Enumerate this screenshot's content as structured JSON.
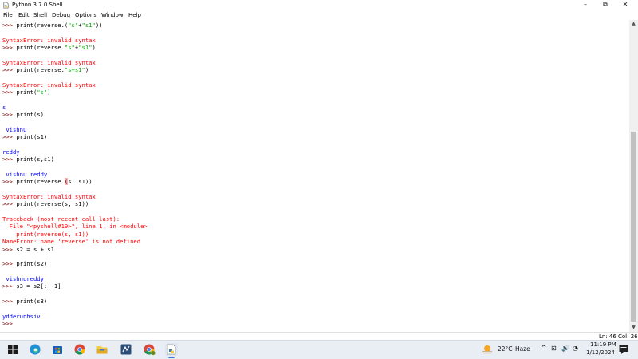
{
  "window": {
    "title": "Python 3.7.0 Shell"
  },
  "window_controls": {
    "minimize": "–",
    "maximize": "⧉",
    "close": "✕"
  },
  "menu": [
    "File",
    "Edit",
    "Shell",
    "Debug",
    "Options",
    "Window",
    "Help"
  ],
  "shell_lines": [
    [
      [
        "prompt",
        ">>> "
      ],
      [
        "code",
        "print(reverse.("
      ],
      [
        "str",
        "\"s\""
      ],
      [
        "code",
        "+"
      ],
      [
        "str",
        "\"s1\""
      ],
      [
        "code",
        "))"
      ]
    ],
    [],
    [
      [
        "err",
        "SyntaxError: invalid syntax"
      ]
    ],
    [
      [
        "prompt",
        ">>> "
      ],
      [
        "code",
        "print(reverse."
      ],
      [
        "str",
        "\"s\""
      ],
      [
        "code",
        "+"
      ],
      [
        "str",
        "\"s1\""
      ],
      [
        "code",
        ")"
      ]
    ],
    [],
    [
      [
        "err",
        "SyntaxError: invalid syntax"
      ]
    ],
    [
      [
        "prompt",
        ">>> "
      ],
      [
        "code",
        "print(reverse."
      ],
      [
        "str",
        "\"s+s1\""
      ],
      [
        "code",
        ")"
      ]
    ],
    [],
    [
      [
        "err",
        "SyntaxError: invalid syntax"
      ]
    ],
    [
      [
        "prompt",
        ">>> "
      ],
      [
        "code",
        "print("
      ],
      [
        "str",
        "\"s\""
      ],
      [
        "code",
        ")"
      ]
    ],
    [],
    [
      [
        "out",
        "s"
      ]
    ],
    [
      [
        "prompt",
        ">>> "
      ],
      [
        "code",
        "print(s)"
      ]
    ],
    [],
    [
      [
        "out",
        " vishnu"
      ]
    ],
    [
      [
        "prompt",
        ">>> "
      ],
      [
        "code",
        "print(s1)"
      ]
    ],
    [],
    [
      [
        "out",
        "reddy"
      ]
    ],
    [
      [
        "prompt",
        ">>> "
      ],
      [
        "code",
        "print(s,s1)"
      ]
    ],
    [],
    [
      [
        "out",
        " vishnu reddy"
      ]
    ],
    [
      [
        "prompt",
        ">>> "
      ],
      [
        "code",
        "print(reverse."
      ],
      [
        "hl",
        "("
      ],
      [
        "code",
        "s, s1))"
      ],
      [
        "cursor",
        ""
      ]
    ],
    [],
    [
      [
        "err",
        "SyntaxError: invalid syntax"
      ]
    ],
    [
      [
        "prompt",
        ">>> "
      ],
      [
        "code",
        "print(reverse(s, s1))"
      ]
    ],
    [],
    [
      [
        "err",
        "Traceback (most recent call last):"
      ]
    ],
    [
      [
        "err",
        "  File \"<pyshell#19>\", line 1, in <module>"
      ]
    ],
    [
      [
        "err",
        "    print(reverse(s, s1))"
      ]
    ],
    [
      [
        "err",
        "NameError: name 'reverse' is not defined"
      ]
    ],
    [
      [
        "prompt",
        ">>> "
      ],
      [
        "code",
        "s2 = s + s1"
      ]
    ],
    [],
    [
      [
        "prompt",
        ">>> "
      ],
      [
        "code",
        "print(s2)"
      ]
    ],
    [],
    [
      [
        "out",
        " vishnureddy"
      ]
    ],
    [
      [
        "prompt",
        ">>> "
      ],
      [
        "code",
        "s3 = s2[::-1]"
      ]
    ],
    [],
    [
      [
        "prompt",
        ">>> "
      ],
      [
        "code",
        "print(s3)"
      ]
    ],
    [],
    [
      [
        "out",
        "ydderunhsiv"
      ]
    ],
    [
      [
        "prompt",
        ">>> "
      ]
    ]
  ],
  "status": {
    "line": "Ln: 46",
    "col": "Col: 26"
  },
  "taskbar": {
    "weather_temp": "22°C",
    "weather_desc": "Haze",
    "time": "11:19 PM",
    "date": "1/12/2024",
    "icons": [
      "windows-start-icon",
      "edge-icon",
      "store-icon",
      "chrome-icon",
      "file-explorer-icon",
      "vscode-icon",
      "chrome-profile-icon",
      "python-idle-icon"
    ]
  },
  "colors": {
    "prompt": "#7f0000",
    "string": "#00aa00",
    "error": "#ff0000",
    "output": "#0000ff"
  }
}
